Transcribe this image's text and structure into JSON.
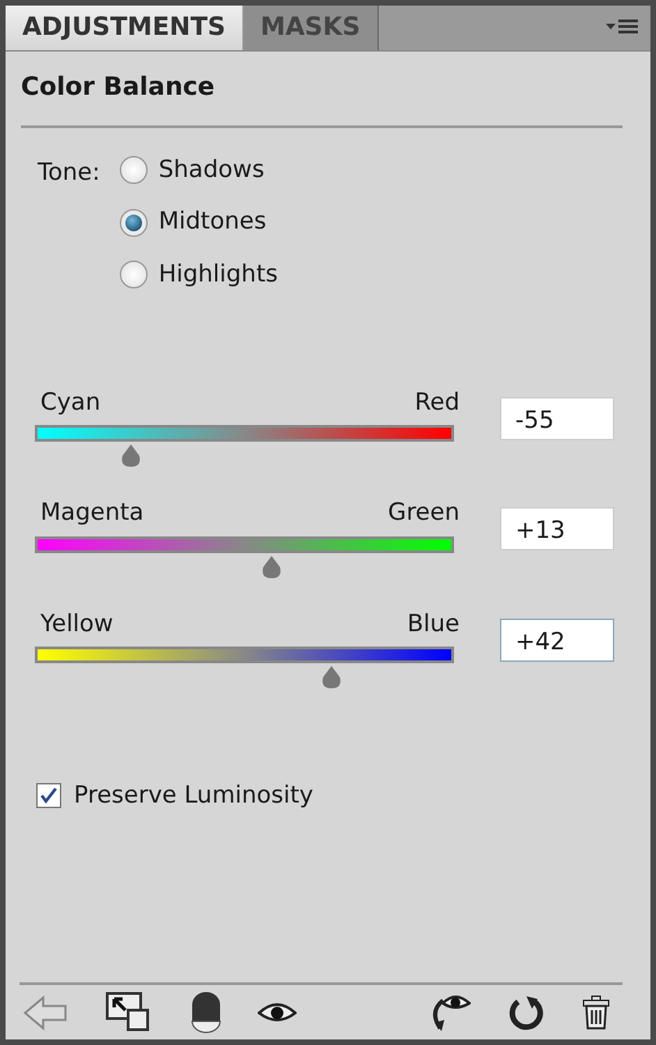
{
  "tabs": [
    {
      "label": "ADJUSTMENTS",
      "selected": true
    },
    {
      "label": "MASKS",
      "selected": false
    }
  ],
  "title": "Color Balance",
  "tone": {
    "label": "Tone:",
    "options": [
      {
        "label": "Shadows",
        "selected": false
      },
      {
        "label": "Midtones",
        "selected": true
      },
      {
        "label": "Highlights",
        "selected": false
      }
    ]
  },
  "sliders": [
    {
      "left": {
        "label": "Cyan",
        "color": "#00ffff"
      },
      "right": {
        "label": "Red",
        "color": "#ff0000"
      },
      "level": 0.225,
      "value": "-55",
      "focused": false
    },
    {
      "left": {
        "label": "Magenta",
        "color": "#ff00ff"
      },
      "right": {
        "label": "Green",
        "color": "#00ff00"
      },
      "level": 0.565,
      "value": "+13",
      "focused": false
    },
    {
      "left": {
        "label": "Yellow",
        "color": "#ffff00"
      },
      "right": {
        "label": "Blue",
        "color": "#0000ff"
      },
      "level": 0.71,
      "value": "+42",
      "focused": true
    }
  ],
  "preserve_luminosity": {
    "label": "Preserve Luminosity",
    "checked": true
  }
}
